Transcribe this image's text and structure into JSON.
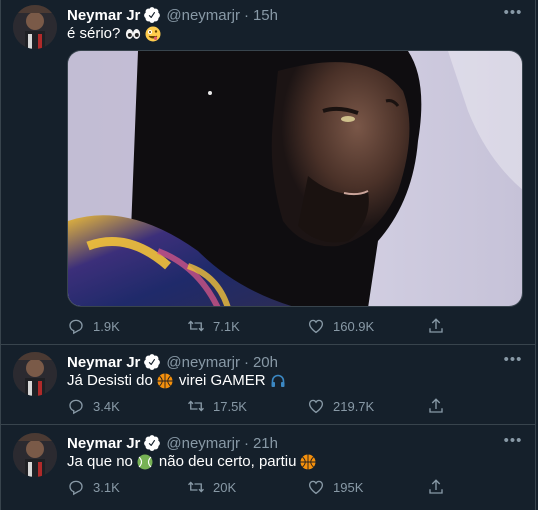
{
  "colors": {
    "background": "#15202b",
    "border": "#38444d",
    "secondary_text": "#8899a6",
    "verified": "#1da1f2"
  },
  "tweets": [
    {
      "name": "Neymar Jr",
      "handle": "@neymarjr",
      "dot": "·",
      "time": "15h",
      "text": "é sério?",
      "text_emojis": [
        "eyes-emoji",
        "zany-face-emoji"
      ],
      "has_media": true,
      "replies": "1.9K",
      "retweets": "7.1K",
      "likes": "160.9K"
    },
    {
      "name": "Neymar Jr",
      "handle": "@neymarjr",
      "dot": "·",
      "time": "20h",
      "text_before": "Já Desisti do",
      "text_after": "virei GAMER",
      "text_emojis": [
        "basketball-emoji",
        "headphone-emoji"
      ],
      "replies": "3.4K",
      "retweets": "17.5K",
      "likes": "219.7K"
    },
    {
      "name": "Neymar Jr",
      "handle": "@neymarjr",
      "dot": "·",
      "time": "21h",
      "text_before": "Ja que no",
      "text_after": "não deu certo, partiu",
      "text_emojis": [
        "tennis-ball-emoji",
        "basketball-emoji"
      ],
      "replies": "3.1K",
      "retweets": "20K",
      "likes": "195K"
    }
  ]
}
